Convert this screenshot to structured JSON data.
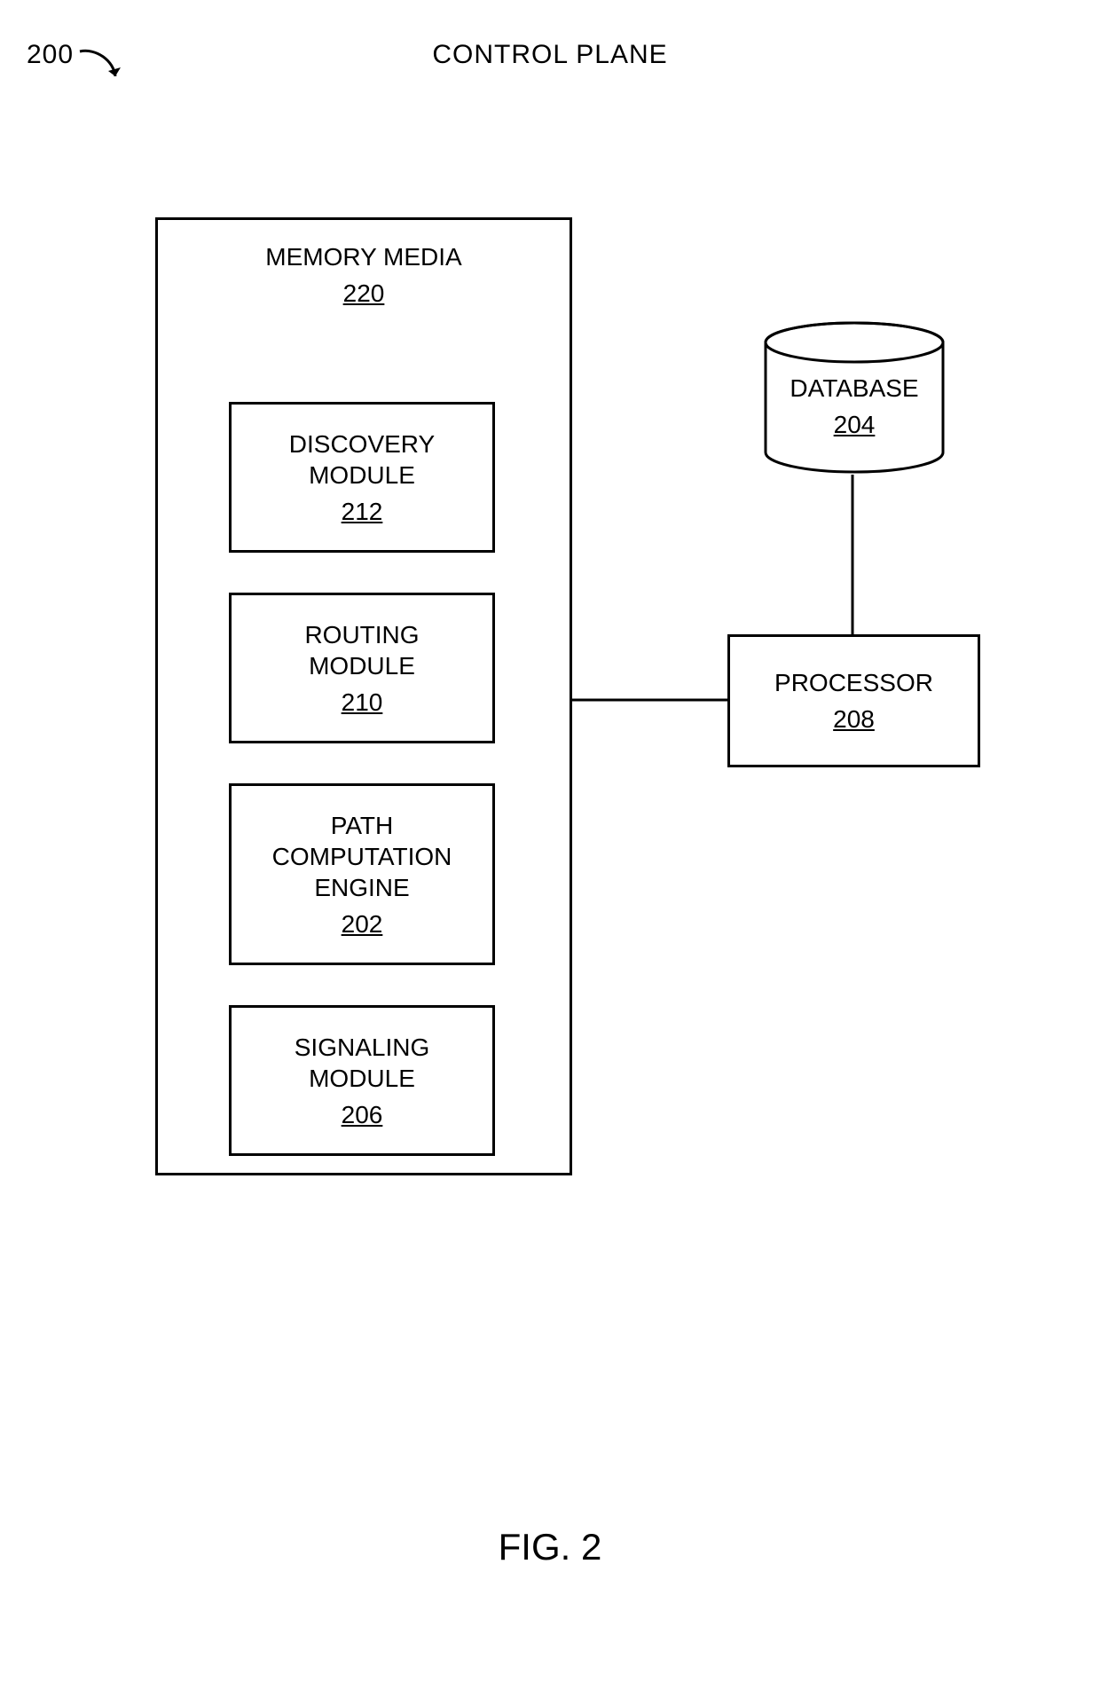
{
  "title": "CONTROL PLANE",
  "figure_number": "200",
  "figure_caption": "FIG. 2",
  "memory_media": {
    "label": "MEMORY MEDIA",
    "ref": "220"
  },
  "discovery": {
    "label": "DISCOVERY MODULE",
    "ref": "212"
  },
  "routing": {
    "label": "ROUTING MODULE",
    "ref": "210"
  },
  "pce": {
    "label": "PATH COMPUTATION ENGINE",
    "ref": "202"
  },
  "signaling": {
    "label": "SIGNALING MODULE",
    "ref": "206"
  },
  "processor": {
    "label": "PROCESSOR",
    "ref": "208"
  },
  "database": {
    "label": "DATABASE",
    "ref": "204"
  }
}
